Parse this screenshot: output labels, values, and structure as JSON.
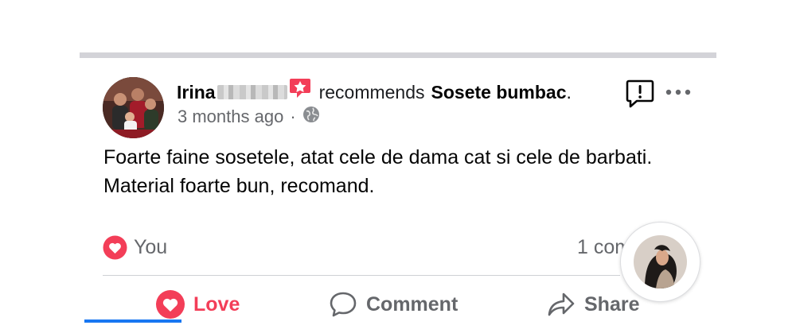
{
  "post": {
    "author_name": "Irina",
    "verb": "recommends",
    "page_name": "Sosete bumbac",
    "period": ".",
    "time_ago": "3 months ago",
    "separator": "·",
    "body": "Foarte faine sosetele, atat cele de dama cat si cele de barbati. Material foarte bun, recomand."
  },
  "reactions": {
    "reactor_label": "You",
    "comment_count_label": "1 comment"
  },
  "actions": {
    "love_label": "Love",
    "comment_label": "Comment",
    "share_label": "Share"
  },
  "icons": {
    "recommend_badge": "star-badge-icon",
    "privacy": "globe-icon",
    "report": "report-icon",
    "more": "more-options-icon",
    "love": "love-icon",
    "comment": "comment-icon",
    "share": "share-icon"
  },
  "colors": {
    "love": "#f33e58",
    "secondary_text": "#65676b",
    "active_tab": "#1877f2"
  }
}
